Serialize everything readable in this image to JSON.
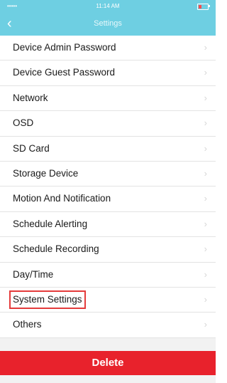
{
  "header": {
    "title": "Settings",
    "back_icon": "chevron-left-icon"
  },
  "status_bar": {
    "time": "11:14 AM",
    "carrier": "•••••"
  },
  "settings": {
    "items": [
      {
        "label": "Device Admin Password"
      },
      {
        "label": "Device Guest Password"
      },
      {
        "label": "Network"
      },
      {
        "label": "OSD"
      },
      {
        "label": "SD Card"
      },
      {
        "label": "Storage Device"
      },
      {
        "label": "Motion And Notification"
      },
      {
        "label": "Schedule Alerting"
      },
      {
        "label": "Schedule Recording"
      },
      {
        "label": "Day/Time"
      },
      {
        "label": "System Settings",
        "highlighted": true
      },
      {
        "label": "Others"
      }
    ],
    "chevron": "›"
  },
  "actions": {
    "delete_label": "Delete"
  },
  "colors": {
    "header_bg": "#6ecfe2",
    "delete_bg": "#e8222c",
    "highlight_border": "#e43b3b"
  }
}
